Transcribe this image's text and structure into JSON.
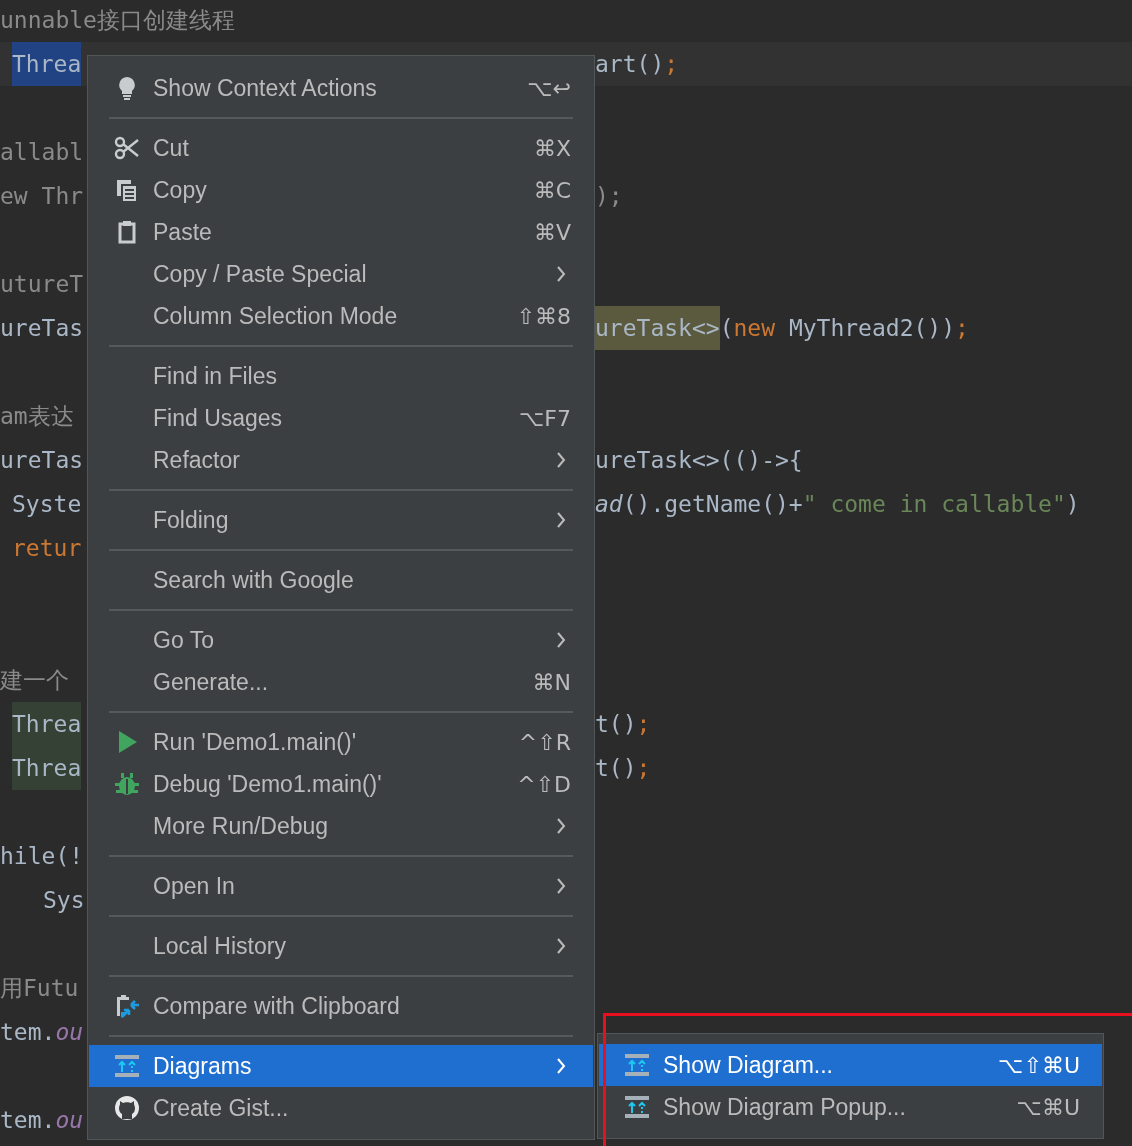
{
  "code_lines": [
    {
      "kind": "code",
      "left": [
        {
          "text": "unnable接口创建线程",
          "kind": "comment"
        }
      ]
    },
    {
      "kind": "code_indented",
      "current": true,
      "left": [
        {
          "text": "Threa",
          "kind": "plain",
          "selected": true
        }
      ],
      "right": [
        {
          "text": "art()",
          "kind": "plain"
        },
        {
          "text": ";",
          "kind": "keyword"
        }
      ]
    },
    {
      "kind": "blank"
    },
    {
      "kind": "code",
      "left": [
        {
          "text": "allabl",
          "kind": "comment"
        }
      ]
    },
    {
      "kind": "code",
      "left": [
        {
          "text": "ew Thr",
          "kind": "comment"
        }
      ],
      "right": [
        {
          "text": ");",
          "kind": "comment"
        }
      ]
    },
    {
      "kind": "blank"
    },
    {
      "kind": "code",
      "left": [
        {
          "text": "utureT",
          "kind": "comment"
        }
      ]
    },
    {
      "kind": "code",
      "left": [
        {
          "text": "ureTas",
          "kind": "plain"
        }
      ],
      "right": [
        {
          "text": "ureTask<>",
          "kind": "plain",
          "read_usage": true
        },
        {
          "text": "(",
          "kind": "plain"
        },
        {
          "text": "new",
          "kind": "keyword"
        },
        {
          "text": " MyThread2())",
          "kind": "plain"
        },
        {
          "text": ";",
          "kind": "keyword"
        }
      ]
    },
    {
      "kind": "blank"
    },
    {
      "kind": "code",
      "left": [
        {
          "text": "am表达",
          "kind": "comment"
        }
      ]
    },
    {
      "kind": "code",
      "left": [
        {
          "text": "ureTas",
          "kind": "plain"
        }
      ],
      "right": [
        {
          "text": "ureTask<>(()->{",
          "kind": "plain"
        }
      ]
    },
    {
      "kind": "code_indented",
      "left": [
        {
          "text": "Syste",
          "kind": "plain"
        }
      ],
      "right": [
        {
          "text": "ad",
          "kind": "italic"
        },
        {
          "text": "().getName()+",
          "kind": "plain"
        },
        {
          "text": "\" come in callable\"",
          "kind": "string"
        },
        {
          "text": ")",
          "kind": "plain"
        }
      ]
    },
    {
      "kind": "code_indented",
      "left": [
        {
          "text": "retur",
          "kind": "keyword"
        }
      ]
    },
    {
      "kind": "blank"
    },
    {
      "kind": "blank"
    },
    {
      "kind": "code",
      "left": [
        {
          "text": "建一个",
          "kind": "comment"
        }
      ]
    },
    {
      "kind": "code_indented",
      "left": [
        {
          "text": "Threa",
          "kind": "plain",
          "write_usage": true
        }
      ],
      "right": [
        {
          "text": "t()",
          "kind": "plain"
        },
        {
          "text": ";",
          "kind": "keyword"
        }
      ]
    },
    {
      "kind": "code_indented",
      "left": [
        {
          "text": "Threa",
          "kind": "plain",
          "write_usage": true
        }
      ],
      "right": [
        {
          "text": "t()",
          "kind": "plain"
        },
        {
          "text": ";",
          "kind": "keyword"
        }
      ]
    },
    {
      "kind": "blank"
    },
    {
      "kind": "code",
      "left": [
        {
          "text": "hile(!",
          "kind": "plain"
        }
      ]
    },
    {
      "kind": "code_deep",
      "left": [
        {
          "text": "Sys",
          "kind": "plain"
        }
      ]
    },
    {
      "kind": "blank"
    },
    {
      "kind": "code",
      "left": [
        {
          "text": "用Futu",
          "kind": "comment"
        }
      ]
    },
    {
      "kind": "code",
      "left": [
        {
          "text": "tem.",
          "kind": "plain"
        },
        {
          "text": "ou",
          "kind": "field"
        }
      ]
    },
    {
      "kind": "blank"
    },
    {
      "kind": "code",
      "left": [
        {
          "text": "tem.",
          "kind": "plain"
        },
        {
          "text": "ou",
          "kind": "field"
        }
      ]
    }
  ],
  "context_menu": {
    "groups": [
      [
        {
          "label": "Show Context Actions",
          "shortcut": "⌥↩",
          "selected": false
        }
      ],
      [
        {
          "label": "Cut",
          "shortcut": "⌘X",
          "selected": false
        },
        {
          "label": "Copy",
          "shortcut": "⌘C",
          "selected": false
        },
        {
          "label": "Paste",
          "shortcut": "⌘V",
          "selected": false
        },
        {
          "label": "Copy / Paste Special",
          "submenu": true,
          "selected": false
        },
        {
          "label": "Column Selection Mode",
          "shortcut": "⇧⌘8",
          "selected": false
        }
      ],
      [
        {
          "label": "Find in Files",
          "selected": false
        },
        {
          "label": "Find Usages",
          "shortcut": "⌥F7",
          "selected": false
        },
        {
          "label": "Refactor",
          "submenu": true,
          "selected": false
        }
      ],
      [
        {
          "label": "Folding",
          "submenu": true,
          "selected": false
        }
      ],
      [
        {
          "label": "Search with Google",
          "selected": false
        }
      ],
      [
        {
          "label": "Go To",
          "submenu": true,
          "selected": false
        },
        {
          "label": "Generate...",
          "shortcut": "⌘N",
          "selected": false
        }
      ],
      [
        {
          "label": "Run 'Demo1.main()'",
          "shortcut": "^⇧R",
          "selected": false
        },
        {
          "label": "Debug 'Demo1.main()'",
          "shortcut": "^⇧D",
          "selected": false
        },
        {
          "label": "More Run/Debug",
          "submenu": true,
          "selected": false
        }
      ],
      [
        {
          "label": "Open In",
          "submenu": true,
          "selected": false
        }
      ],
      [
        {
          "label": "Local History",
          "submenu": true,
          "selected": false
        }
      ],
      [
        {
          "label": "Compare with Clipboard",
          "selected": false
        }
      ],
      [
        {
          "label": "Diagrams",
          "submenu": true,
          "selected": true
        },
        {
          "label": "Create Gist...",
          "selected": false
        }
      ]
    ]
  },
  "submenu": {
    "items": [
      {
        "label": "Show Diagram...",
        "shortcut": "⌥⇧⌘U",
        "selected": true
      },
      {
        "label": "Show Diagram Popup...",
        "shortcut": "⌥⌘U",
        "selected": false
      }
    ]
  }
}
